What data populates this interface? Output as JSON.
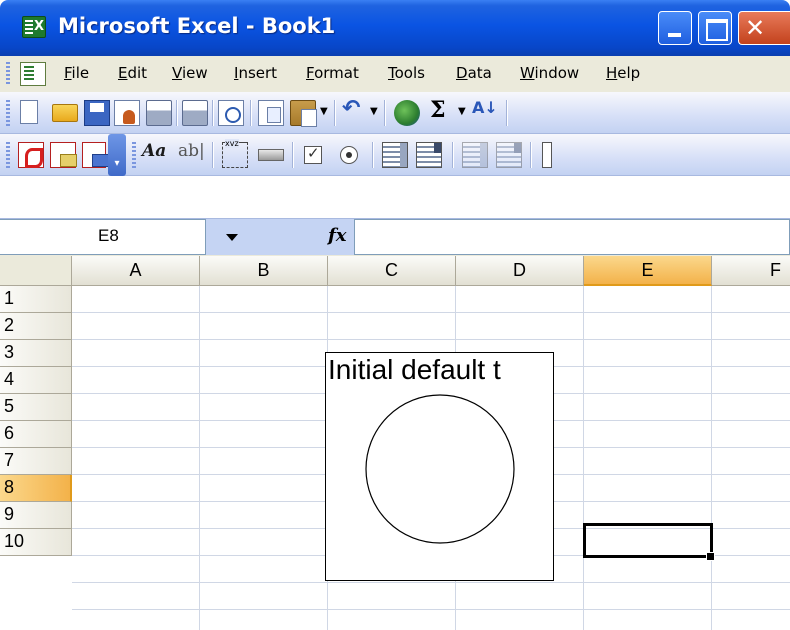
{
  "window": {
    "title": "Microsoft Excel - Book1",
    "close_glyph": "✕"
  },
  "menu": {
    "items": [
      "File",
      "Edit",
      "View",
      "Insert",
      "Format",
      "Tools",
      "Data",
      "Window",
      "Help"
    ]
  },
  "toolbar_standard": {
    "icons": [
      "new-icon",
      "open-icon",
      "save-icon",
      "permission-icon",
      "print-icon",
      "print-preview-icon",
      "research-icon",
      "copy-icon",
      "paste-icon",
      "undo-icon",
      "hyperlink-icon",
      "autosum-icon",
      "sort-ascending-icon"
    ],
    "sigma": "Σ",
    "sort": "A↓",
    "undo": "↶"
  },
  "toolbar_forms": {
    "icons": [
      "convert-to-pdf-icon",
      "pdf-email-icon",
      "pdf-review-icon",
      "label-icon",
      "edit-box-icon",
      "group-box-icon",
      "button-icon",
      "checkbox-icon",
      "option-button-icon",
      "list-box-icon",
      "combo-box-icon",
      "spinner-icon"
    ],
    "label_text": "Aa",
    "editbox_text": "ab|"
  },
  "formula_bar": {
    "name_box": "E8",
    "fx_label": "fx",
    "formula": ""
  },
  "grid": {
    "columns": [
      "A",
      "B",
      "C",
      "D",
      "E",
      "F"
    ],
    "rows": [
      "1",
      "2",
      "3",
      "4",
      "5",
      "6",
      "7",
      "8",
      "9",
      "10"
    ],
    "selected_column": "E",
    "selected_row": "8",
    "active_cell": "E8"
  },
  "drawn_object": {
    "label": "Initial default t"
  },
  "colors": {
    "title_bar": "#0a54e3",
    "selection_header": "#f3b24a",
    "gridline": "#d0d7e5"
  }
}
